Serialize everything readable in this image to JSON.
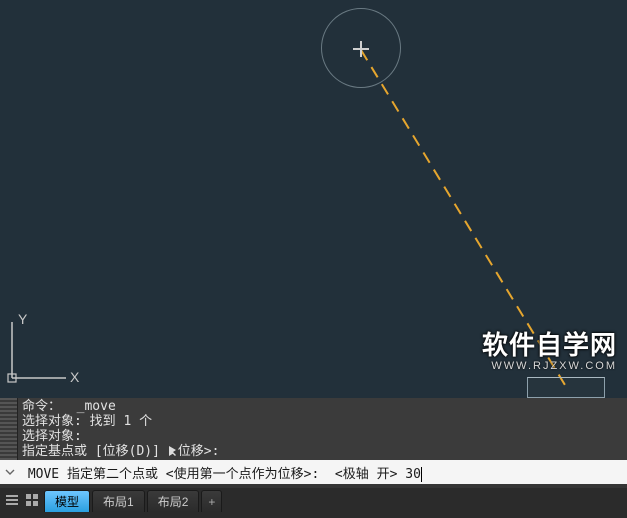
{
  "ucs": {
    "x_label": "X",
    "y_label": "Y"
  },
  "watermark": {
    "cn": "软件自学网",
    "en": "WWW.RJZXW.COM"
  },
  "cmd_history": {
    "line1": "命令：  _move",
    "line2": "选择对象: 找到 1 个",
    "line3": "选择对象:",
    "line4_prefix": "指定基点或 [位移(D)] ",
    "line4_suffix": "位移>:"
  },
  "cmd_input": {
    "leader": " MOVE ",
    "body": "指定第二个点或 <使用第一个点作为位移>:  <极轴 开> ",
    "value": "30"
  },
  "tabs": {
    "model": "模型",
    "layout1": "布局1",
    "layout2": "布局2",
    "plus": "+"
  }
}
